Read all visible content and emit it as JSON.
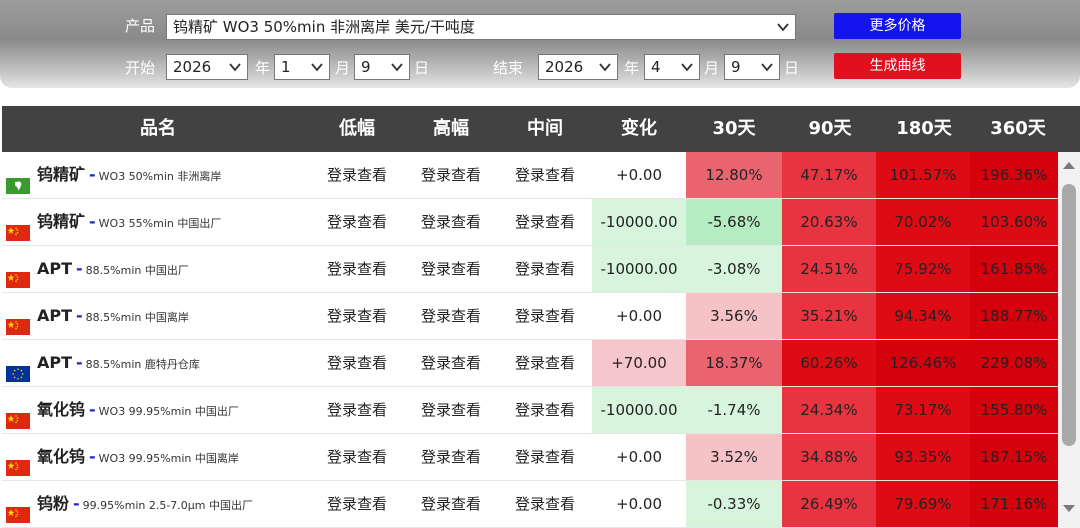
{
  "filter": {
    "product_label": "产品",
    "product_value": "钨精矿 WO3 50%min 非洲离岸 美元/干吨度",
    "start_label": "开始",
    "start_year": "2026",
    "year_unit": "年",
    "start_month": "1",
    "month_unit": "月",
    "start_day": "9",
    "day_unit": "日",
    "end_label": "结束",
    "end_year": "2026",
    "end_month": "4",
    "end_day": "9",
    "more_price_button": "更多价格",
    "generate_curve_button": "生成曲线",
    "more_price_color": "#1414f0",
    "generate_color": "#e0101e"
  },
  "table": {
    "columns": [
      "品名",
      "低幅",
      "高幅",
      "中间",
      "变化",
      "30天",
      "90天",
      "180天",
      "360天"
    ],
    "rows": [
      {
        "flag": "africa-flag",
        "name": "钨精矿",
        "spec": "WO3 50%min 非洲离岸",
        "low": "登录查看",
        "high": "登录查看",
        "mid": "登录查看",
        "change": "+0.00",
        "d30": "12.80%",
        "d90": "47.17%",
        "d180": "101.57%",
        "d360": "196.36%"
      },
      {
        "flag": "china-flag",
        "name": "钨精矿",
        "spec": "WO3 55%min 中国出厂",
        "low": "登录查看",
        "high": "登录查看",
        "mid": "登录查看",
        "change": "-10000.00",
        "d30": "-5.68%",
        "d90": "20.63%",
        "d180": "70.02%",
        "d360": "103.60%"
      },
      {
        "flag": "china-flag",
        "name": "APT",
        "spec": "88.5%min 中国出厂",
        "low": "登录查看",
        "high": "登录查看",
        "mid": "登录查看",
        "change": "-10000.00",
        "d30": "-3.08%",
        "d90": "24.51%",
        "d180": "75.92%",
        "d360": "161.85%"
      },
      {
        "flag": "china-flag",
        "name": "APT",
        "spec": "88.5%min 中国离岸",
        "low": "登录查看",
        "high": "登录查看",
        "mid": "登录查看",
        "change": "+0.00",
        "d30": "3.56%",
        "d90": "35.21%",
        "d180": "94.34%",
        "d360": "188.77%"
      },
      {
        "flag": "eu-flag",
        "name": "APT",
        "spec": "88.5%min 鹿特丹仓库",
        "low": "登录查看",
        "high": "登录查看",
        "mid": "登录查看",
        "change": "+70.00",
        "d30": "18.37%",
        "d90": "60.26%",
        "d180": "126.46%",
        "d360": "229.08%"
      },
      {
        "flag": "china-flag",
        "name": "氧化钨",
        "spec": "WO3 99.95%min 中国出厂",
        "low": "登录查看",
        "high": "登录查看",
        "mid": "登录查看",
        "change": "-10000.00",
        "d30": "-1.74%",
        "d90": "24.34%",
        "d180": "73.17%",
        "d360": "155.80%"
      },
      {
        "flag": "china-flag",
        "name": "氧化钨",
        "spec": "WO3 99.95%min 中国离岸",
        "low": "登录查看",
        "high": "登录查看",
        "mid": "登录查看",
        "change": "+0.00",
        "d30": "3.52%",
        "d90": "34.88%",
        "d180": "93.35%",
        "d360": "187.15%"
      },
      {
        "flag": "china-flag",
        "name": "钨粉",
        "spec": "99.95%min 2.5-7.0μm 中国出厂",
        "low": "登录查看",
        "high": "登录查看",
        "mid": "登录查看",
        "change": "+0.00",
        "d30": "-0.33%",
        "d90": "26.49%",
        "d180": "79.69%",
        "d360": "171.16%"
      }
    ]
  },
  "colors": {
    "header_bg": "#424242",
    "negative_change_bg": "#d6f5dc",
    "positive_change_bg": "#f5c6ca",
    "strong_red": "#de0a14"
  }
}
